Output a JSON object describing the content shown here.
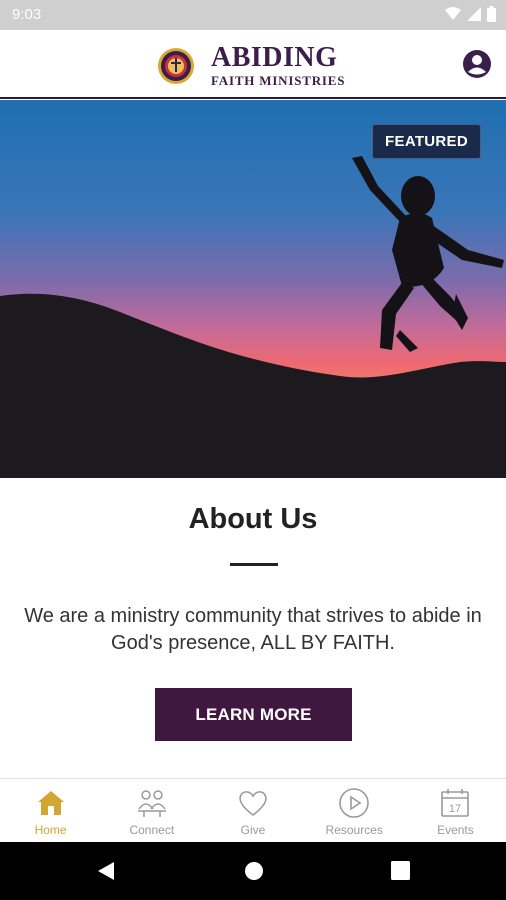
{
  "status_bar": {
    "time": "9:03"
  },
  "header": {
    "logo_title": "ABIDING",
    "logo_subtitle": "FAITH MINISTRIES",
    "brand_color": "#3a1e4b",
    "accent_gold": "#d3a533"
  },
  "hero": {
    "badge": "FEATURED"
  },
  "about": {
    "title": "About Us",
    "description": "We are a ministry community that strives to abide in God's presence, ALL BY FAITH.",
    "cta_label": "LEARN MORE",
    "cta_color": "#40183f"
  },
  "bottom_nav": {
    "items": [
      {
        "label": "Home",
        "icon": "home-icon",
        "active": true
      },
      {
        "label": "Connect",
        "icon": "people-icon",
        "active": false
      },
      {
        "label": "Give",
        "icon": "heart-icon",
        "active": false
      },
      {
        "label": "Resources",
        "icon": "play-icon",
        "active": false
      },
      {
        "label": "Events",
        "icon": "calendar-icon",
        "active": false
      }
    ],
    "calendar_day": "17"
  },
  "icons": {
    "status": [
      "wifi-icon",
      "signal-icon",
      "battery-icon"
    ],
    "header": [
      "logo-seal-icon",
      "profile-icon"
    ],
    "system": [
      "back-icon",
      "home-circle-icon",
      "recents-icon"
    ]
  }
}
